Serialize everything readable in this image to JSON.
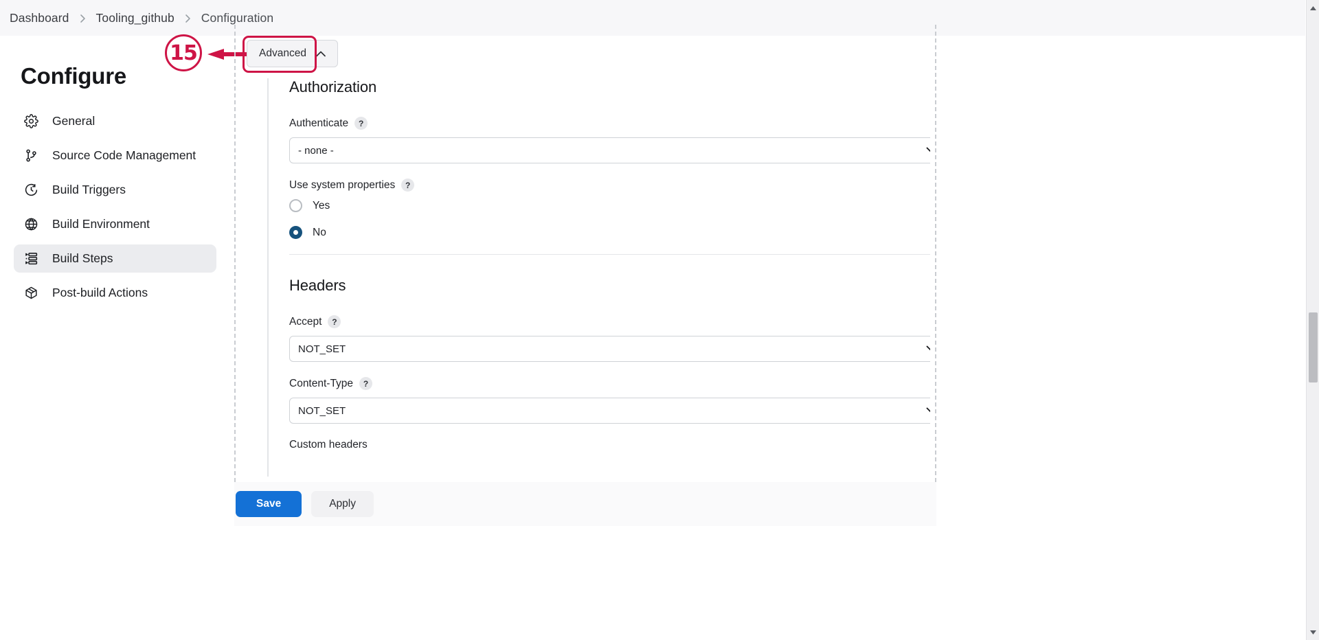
{
  "breadcrumb": {
    "items": [
      {
        "label": "Dashboard"
      },
      {
        "label": "Tooling_github"
      },
      {
        "label": "Configuration"
      }
    ]
  },
  "sidebar": {
    "title": "Configure",
    "items": [
      {
        "label": "General",
        "icon": "gear-icon",
        "active": false
      },
      {
        "label": "Source Code Management",
        "icon": "branch-icon",
        "active": false
      },
      {
        "label": "Build Triggers",
        "icon": "clock-icon",
        "active": false
      },
      {
        "label": "Build Environment",
        "icon": "globe-icon",
        "active": false
      },
      {
        "label": "Build Steps",
        "icon": "list-icon",
        "active": true
      },
      {
        "label": "Post-build Actions",
        "icon": "package-icon",
        "active": false
      }
    ]
  },
  "annotation": {
    "number": "15",
    "color": "#ce1446"
  },
  "main": {
    "advanced_button": {
      "label": "Advanced",
      "icon": "chevron-up-icon",
      "highlighted": true,
      "highlight_color": "#ce1446"
    },
    "sections": [
      {
        "title": "Authorization",
        "fields": [
          {
            "type": "select",
            "label": "Authenticate",
            "help": "?",
            "value": "- none -"
          },
          {
            "type": "radio-group",
            "label": "Use system properties",
            "help": "?",
            "options": [
              {
                "label": "Yes",
                "checked": false
              },
              {
                "label": "No",
                "checked": true
              }
            ],
            "checked_color": "#16527d"
          }
        ]
      },
      {
        "title": "Headers",
        "fields": [
          {
            "type": "select",
            "label": "Accept",
            "help": "?",
            "value": "NOT_SET"
          },
          {
            "type": "select",
            "label": "Content-Type",
            "help": "?",
            "value": "NOT_SET"
          },
          {
            "type": "label",
            "label": "Custom headers"
          }
        ]
      }
    ]
  },
  "footer": {
    "save_label": "Save",
    "apply_label": "Apply",
    "save_color": "#1471d6"
  },
  "scrollbar": {
    "up_icon": "scroll-up-arrow-icon",
    "down_icon": "scroll-down-arrow-icon"
  }
}
